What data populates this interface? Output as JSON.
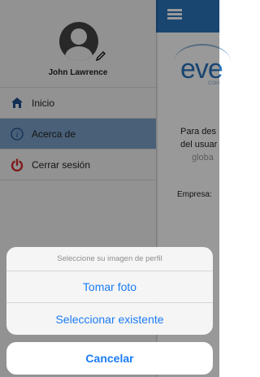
{
  "colors": {
    "brand_blue": "#2a74bd",
    "active_menu": "#7aa0c8",
    "ios_blue": "#1a7cf5",
    "logout_red": "#d42a2a"
  },
  "drawer": {
    "user_name": "John Lawrence",
    "items": [
      {
        "label": "Inicio",
        "icon": "home-icon",
        "active": false
      },
      {
        "label": "Acerca de",
        "icon": "info-icon",
        "active": true
      },
      {
        "label": "Cerrar sesión",
        "icon": "power-icon",
        "active": false
      }
    ]
  },
  "main": {
    "logo": "eve",
    "logo_sub": "CGM",
    "lines": [
      "Para des",
      "del usuar",
      "globa"
    ],
    "empresa_label": "Empresa:"
  },
  "action_sheet": {
    "title": "Seleccione su imagen de perfil",
    "options": [
      "Tomar foto",
      "Seleccionar existente"
    ],
    "cancel": "Cancelar"
  }
}
